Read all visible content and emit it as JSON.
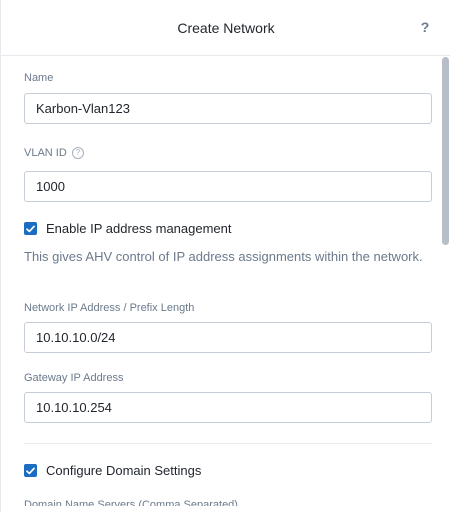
{
  "header": {
    "title": "Create Network",
    "help_symbol": "?"
  },
  "form": {
    "name": {
      "label": "Name",
      "value": "Karbon-Vlan123"
    },
    "vlan_id": {
      "label": "VLAN ID",
      "info_symbol": "?",
      "value": "1000"
    },
    "ipam": {
      "label": "Enable IP address management",
      "checked": true,
      "description": "This gives AHV control of IP address assignments within the network."
    },
    "network_ip": {
      "label": "Network IP Address / Prefix Length",
      "value": "10.10.10.0/24"
    },
    "gateway_ip": {
      "label": "Gateway IP Address",
      "value": "10.10.10.254"
    },
    "domain_settings": {
      "label": "Configure Domain Settings",
      "checked": true
    },
    "dns_servers": {
      "label": "Domain Name Servers (Comma Separated)"
    }
  },
  "colors": {
    "accent": "#1b6dc1",
    "border": "#c7cdd6",
    "muted_text": "#6b7a8c"
  }
}
